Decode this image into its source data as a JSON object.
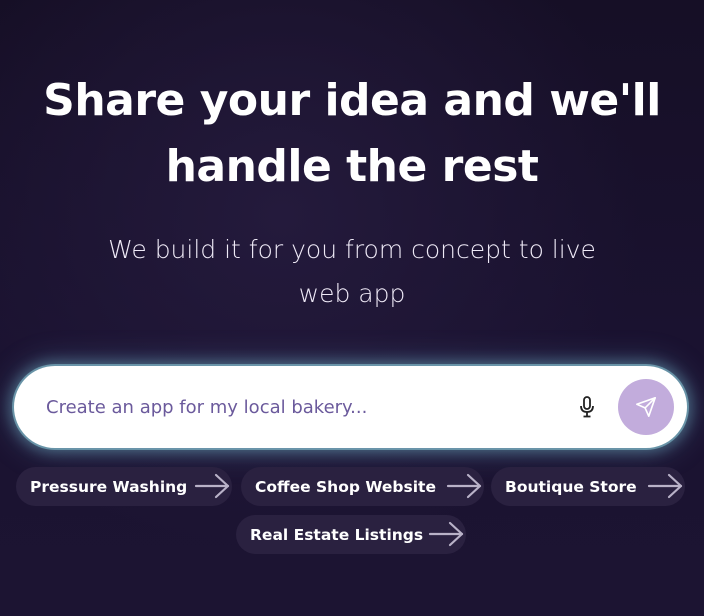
{
  "hero": {
    "headline_line1": "Share your idea and we'll",
    "headline_line2": "handle the rest",
    "subhead_line1": "We build it for you from concept to live",
    "subhead_line2": "web app"
  },
  "prompt": {
    "placeholder": "Create an app for my local bakery...",
    "value": "",
    "mic_icon": "microphone-icon",
    "send_icon": "paper-plane-icon",
    "send_button_color": "#c2acdc"
  },
  "suggestions": [
    {
      "label": "Pressure Washing",
      "icon": "arrow-right-icon"
    },
    {
      "label": "Coffee Shop Website",
      "icon": "arrow-right-icon"
    },
    {
      "label": "Boutique Store",
      "icon": "arrow-right-icon"
    },
    {
      "label": "Real Estate Listings",
      "icon": "arrow-right-icon"
    }
  ],
  "colors": {
    "background": "#1a1230",
    "chip_background": "#2a2140",
    "input_glow": "#78becd"
  }
}
